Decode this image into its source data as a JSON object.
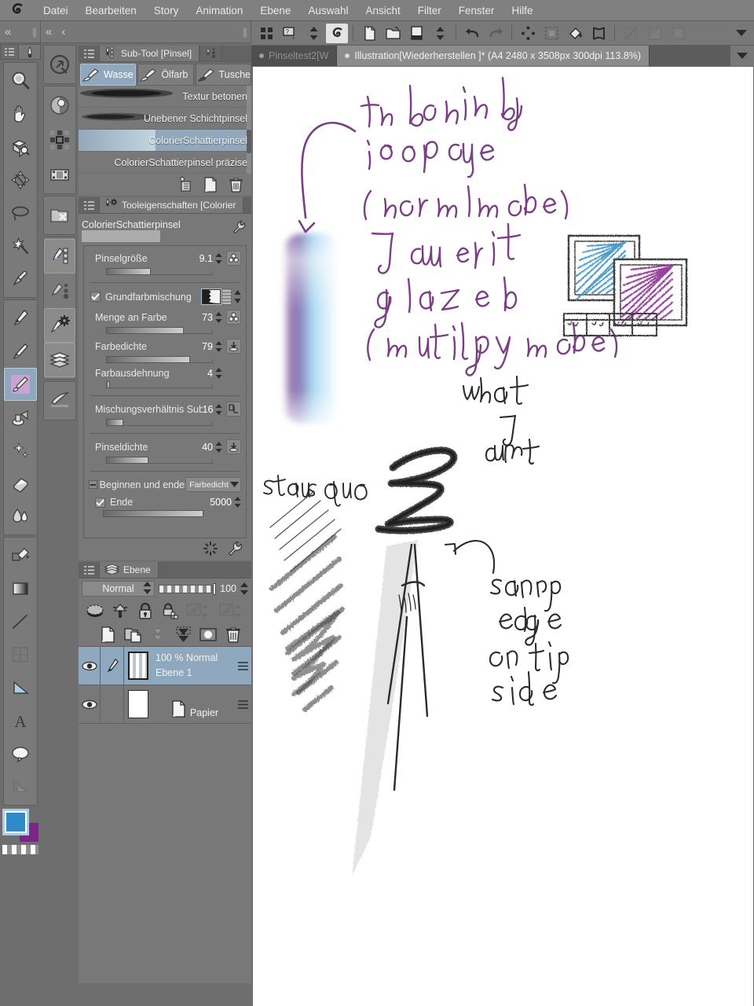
{
  "app": {
    "logo_icon": "clip-studio-paint-logo"
  },
  "menubar": {
    "items": [
      {
        "label": "Datei"
      },
      {
        "label": "Bearbeiten"
      },
      {
        "label": "Story"
      },
      {
        "label": "Animation"
      },
      {
        "label": "Ebene"
      },
      {
        "label": "Auswahl"
      },
      {
        "label": "Ansicht"
      },
      {
        "label": "Filter"
      },
      {
        "label": "Fenster"
      },
      {
        "label": "Hilfe"
      }
    ]
  },
  "toolbar": {
    "buttons": [
      {
        "name": "grid-view-icon",
        "state": "normal"
      },
      {
        "name": "quick-access-icon",
        "state": "normal"
      },
      {
        "name": "updown-arrows-icon",
        "state": "normal"
      },
      {
        "name": "clip-studio-swirl-icon",
        "state": "active"
      },
      {
        "name": "new-document-icon",
        "state": "normal"
      },
      {
        "name": "open-file-icon",
        "state": "normal"
      },
      {
        "name": "save-file-icon",
        "state": "normal"
      },
      {
        "name": "updown-arrows-2-icon",
        "state": "normal"
      },
      {
        "name": "undo-icon",
        "state": "normal"
      },
      {
        "name": "redo-icon",
        "state": "disabled"
      },
      {
        "name": "clear-selection-icon",
        "state": "normal"
      },
      {
        "name": "fill-selection-icon",
        "state": "normal"
      },
      {
        "name": "fill-bucket-icon",
        "state": "normal"
      },
      {
        "name": "transform-icon",
        "state": "normal"
      },
      {
        "name": "selection-invert-icon",
        "state": "disabled"
      },
      {
        "name": "selection-fill-icon",
        "state": "disabled"
      },
      {
        "name": "selection-border-icon",
        "state": "disabled"
      }
    ],
    "overflow_icon": "chevron-down-icon"
  },
  "doctabs": {
    "tabs": [
      {
        "label": "Pinseltest2[W",
        "active": false
      },
      {
        "label": "Illustration[Wiederherstellen  ]* (A4 2480 x 3508px 300dpi 113.8%)",
        "active": true
      }
    ],
    "overflow_icon": "chevron-down-icon"
  },
  "strips": {
    "left_collapse_icon": "double-chevron-left-icon",
    "second_collapse_icon": "double-chevron-left-icon",
    "second_back_icon": "chevron-left-icon"
  },
  "toolcolumn": {
    "tools": [
      {
        "name": "tool-magnifier",
        "icon": "magnifier-icon",
        "selected": false,
        "dimmed": false
      },
      {
        "name": "tool-move-hand",
        "icon": "hand-icon",
        "selected": false,
        "dimmed": false
      },
      {
        "name": "tool-rotate-canvas",
        "icon": "rotate-box-icon",
        "selected": false,
        "dimmed": false
      },
      {
        "name": "tool-move-layer",
        "icon": "move-arrows-icon",
        "selected": false,
        "dimmed": false
      },
      {
        "name": "tool-select-lasso",
        "icon": "lasso-icon",
        "selected": false,
        "dimmed": false
      },
      {
        "name": "tool-auto-select",
        "icon": "magic-wand-icon",
        "selected": false,
        "dimmed": false
      },
      {
        "name": "tool-eyedropper",
        "icon": "eyedropper-icon",
        "selected": false,
        "dimmed": false
      },
      {
        "name": "tool-pen",
        "icon": "pen-icon",
        "selected": false,
        "dimmed": false
      },
      {
        "name": "tool-pencil",
        "icon": "pencil-icon",
        "selected": false,
        "dimmed": false
      },
      {
        "name": "tool-brush",
        "icon": "brush-icon",
        "selected": true,
        "dimmed": false
      },
      {
        "name": "tool-airbrush",
        "icon": "airbrush-icon",
        "selected": false,
        "dimmed": false
      },
      {
        "name": "tool-decoration",
        "icon": "sparkle-icon",
        "selected": false,
        "dimmed": false
      },
      {
        "name": "tool-eraser",
        "icon": "eraser-icon",
        "selected": false,
        "dimmed": false
      },
      {
        "name": "tool-blend",
        "icon": "blend-drop-icon",
        "selected": false,
        "dimmed": false
      },
      {
        "name": "tool-fill",
        "icon": "paint-bucket-icon",
        "selected": false,
        "dimmed": false
      },
      {
        "name": "tool-gradient",
        "icon": "gradient-icon",
        "selected": false,
        "dimmed": false
      },
      {
        "name": "tool-figure-line",
        "icon": "line-icon",
        "selected": false,
        "dimmed": false
      },
      {
        "name": "tool-frame-border",
        "icon": "frame-border-icon",
        "selected": false,
        "dimmed": true
      },
      {
        "name": "tool-ruler",
        "icon": "ruler-triangle-icon",
        "selected": false,
        "dimmed": false
      },
      {
        "name": "tool-text",
        "icon": "text-a-icon",
        "selected": false,
        "dimmed": false
      },
      {
        "name": "tool-balloon",
        "icon": "speech-balloon-icon",
        "selected": false,
        "dimmed": false
      },
      {
        "name": "tool-correct-line",
        "icon": "correct-line-icon",
        "selected": false,
        "dimmed": true
      }
    ],
    "color_swatches": {
      "main_color": "#2e8ac9",
      "sub_color": "#7b2585",
      "transparent_icon": "checkerboard-transparent-icon"
    }
  },
  "toolcolumn2": {
    "tools": [
      {
        "name": "nav-quick-access",
        "icon": "quick-access-circle-icon",
        "selected": false
      },
      {
        "name": "nav-color-wheel",
        "icon": "color-wheel-icon",
        "selected": false
      },
      {
        "name": "nav-color-set",
        "icon": "color-set-icon",
        "selected": false
      },
      {
        "name": "nav-timeline",
        "icon": "film-strip-icon",
        "selected": false
      },
      {
        "name": "nav-material-none",
        "icon": "material-folder-x-icon",
        "selected": false
      },
      {
        "name": "nav-subtool",
        "icon": "subtool-list-icon",
        "selected": true
      },
      {
        "name": "nav-subtool-detail",
        "icon": "subtool-detail-icon",
        "selected": false
      },
      {
        "name": "nav-tool-property",
        "icon": "tool-property-gear-icon",
        "selected": true
      },
      {
        "name": "nav-layer",
        "icon": "layer-stack-icon",
        "selected": true
      },
      {
        "name": "nav-quick-brush",
        "icon": "brush-stroke-icon",
        "selected": false
      }
    ]
  },
  "subtool_palette": {
    "menu_icon": "palette-menu-icon",
    "tab_label": "Sub-Tool [Pinsel]",
    "tab_icon": "subtool-icon",
    "tab2_icon": "subtool-detail-icon",
    "categories": [
      {
        "label": "Wasse",
        "icon": "watercolor-brush-icon",
        "selected": true
      },
      {
        "label": "Ölfarb",
        "icon": "oil-brush-icon",
        "selected": false
      },
      {
        "label": "Tusche",
        "icon": "ink-brush-icon",
        "selected": false
      }
    ],
    "items": [
      {
        "label": "Textur betonen",
        "selected": false
      },
      {
        "label": "Unebener Schichtpinsel",
        "selected": false
      },
      {
        "label": "ColorierSchattierpinsel",
        "selected": true
      },
      {
        "label": "ColorierSchattierpinsel präzise",
        "selected": false
      }
    ],
    "footer_buttons": [
      {
        "name": "copy-subtool-button",
        "icon": "copy-icon"
      },
      {
        "name": "new-subtool-button",
        "icon": "new-page-icon"
      },
      {
        "name": "delete-subtool-button",
        "icon": "trash-icon"
      }
    ]
  },
  "tool_properties": {
    "menu_icon": "palette-menu-icon",
    "tab_label": "Tooleigenschaften [Colorier",
    "tab_icon": "tool-property-gear-icon",
    "tool_name": "ColorierSchattierpinsel",
    "wrench_icon": "wrench-icon",
    "properties": [
      {
        "name": "brush-size",
        "label": "Pinselgröße",
        "value": "9.1",
        "fill_pct": 42,
        "icon": "pressure-icon"
      },
      {
        "name": "base-color-mixing",
        "label": "Grundfarbmischung",
        "value": "",
        "checkbox": true,
        "swatch": true
      },
      {
        "name": "paint-amount",
        "label": "Menge an Farbe",
        "value": "73",
        "fill_pct": 73,
        "icon": "pressure-icon"
      },
      {
        "name": "paint-density",
        "label": "Farbedichte",
        "value": "79",
        "fill_pct": 79,
        "icon": "pressure-down-icon"
      },
      {
        "name": "color-stretch",
        "label": "Farbausdehnung",
        "value": "4",
        "fill_pct": 4,
        "icon": ""
      },
      {
        "name": "blending-ratio-sub",
        "label": "Mischungsverhältnis Sub",
        "value": "16",
        "fill_pct": 16,
        "icon": "sub-blend-icon"
      },
      {
        "name": "brush-density",
        "label": "Pinseldichte",
        "value": "40",
        "fill_pct": 40,
        "icon": "pressure-down-icon"
      },
      {
        "name": "start-and-end",
        "label": "Beginnen und enden",
        "value": "",
        "combo": "Farbedicht"
      },
      {
        "name": "end",
        "label": "Ende",
        "value": "5000",
        "fill_pct": 100,
        "checkbox": true
      }
    ],
    "footer_buttons": [
      {
        "name": "reset-tool-button",
        "icon": "reset-icon"
      },
      {
        "name": "tool-settings-button",
        "icon": "wrench-icon"
      }
    ]
  },
  "layer_palette": {
    "menu_icon": "palette-menu-icon",
    "tab_label": "Ebene",
    "tab_icon": "layer-stack-icon",
    "blend_mode": "Normal",
    "opacity": "100",
    "toolbar_buttons": [
      {
        "name": "layer-mask-button",
        "icon": "layer-mask-icon",
        "dim": false
      },
      {
        "name": "ruler-visibility-button",
        "icon": "ruler-range-icon",
        "dim": false
      },
      {
        "name": "lock-layer-button",
        "icon": "lock-icon",
        "dim": false
      },
      {
        "name": "lock-transparent-button",
        "icon": "lock-transparent-icon",
        "dim": false
      },
      {
        "name": "clip-to-layer-button",
        "icon": "clip-layer-icon",
        "dim": true
      },
      {
        "name": "ref-layer-button",
        "icon": "reference-layer-icon",
        "dim": true
      }
    ],
    "action_buttons": [
      {
        "name": "new-raster-layer-button",
        "icon": "new-page-icon"
      },
      {
        "name": "new-layer-folder-button",
        "icon": "new-folder-icon"
      },
      {
        "name": "transfer-down-button",
        "icon": "transfer-down-icon"
      },
      {
        "name": "merge-down-button",
        "icon": "merge-down-icon"
      },
      {
        "name": "layer-mask-create-button",
        "icon": "mask-circle-icon"
      },
      {
        "name": "delete-layer-button",
        "icon": "trash-icon"
      }
    ],
    "layers": [
      {
        "name": "layer-ebene-1",
        "meta": "100 % Normal",
        "title": "Ebene 1",
        "selected": true,
        "visible": true,
        "has_pen_marker": true,
        "thumb": "transparent-checker"
      },
      {
        "name": "layer-papier",
        "meta": "",
        "title": "Papier",
        "selected": false,
        "visible": true,
        "has_pen_marker": false,
        "thumb": "white-paper"
      }
    ]
  },
  "canvas": {
    "background": "#ffffff",
    "annotations": [
      {
        "name": "note-blending-opaque",
        "text": "the blending is opaque (normal mode)",
        "color": "#7a3d86"
      },
      {
        "name": "note-want-glazed",
        "text": "I want it glazed (multiply mode)",
        "color": "#7a3d86"
      },
      {
        "name": "note-status-quo",
        "text": "status quo",
        "color": "#2b2b2b"
      },
      {
        "name": "note-what-i-want",
        "text": "what I want",
        "color": "#2b2b2b"
      },
      {
        "name": "note-sharp-edge",
        "text": "sharp edge on tip side",
        "color": "#2b2b2b"
      }
    ],
    "swatch_gradient": {
      "from": "#7b5fa0",
      "to": "#a8d8f0"
    },
    "thumbnail_squares": {
      "blue": "#3f93c4",
      "purple": "#8e3194"
    }
  }
}
